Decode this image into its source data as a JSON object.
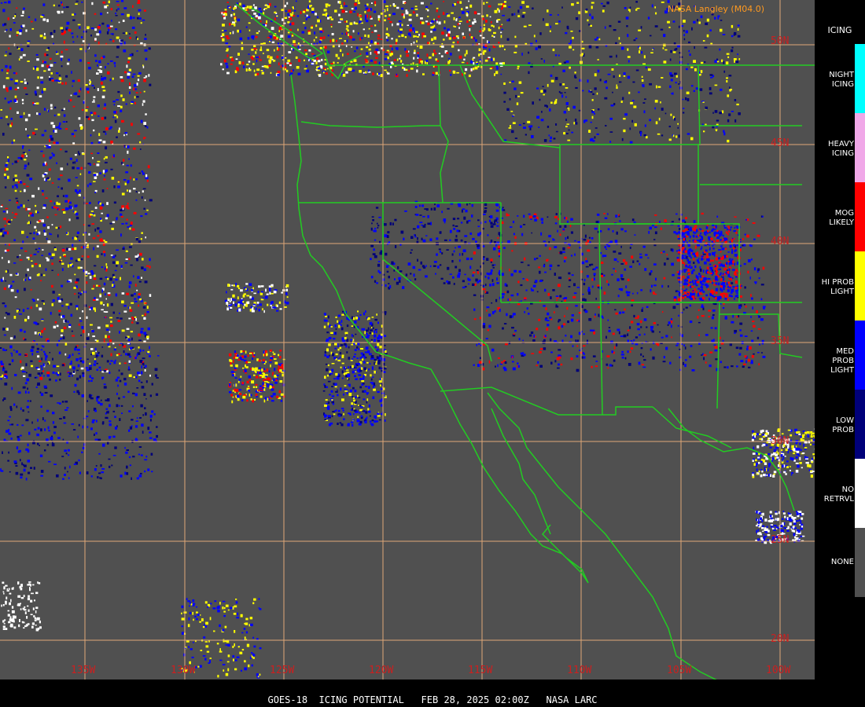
{
  "header": {
    "credit": "NASA Langley (M04.0)"
  },
  "footer": {
    "text": "GOES-18  ICING POTENTIAL   FEB 28, 2025 02:00Z   NASA LARC"
  },
  "legend": {
    "title": "ICING",
    "items": [
      {
        "label": "NIGHT\nICING",
        "color": "#00ffff"
      },
      {
        "label": "HEAVY\nICING",
        "color": "#f0a8e8"
      },
      {
        "label": "MOG\nLIKELY",
        "color": "#ff0000"
      },
      {
        "label": "HI PROB\nLIGHT",
        "color": "#ffff00"
      },
      {
        "label": "MED PROB\nLIGHT",
        "color": "#0000ff"
      },
      {
        "label": "LOW\nPROB",
        "color": "#00007a"
      },
      {
        "label": "NO\nRETRVL",
        "color": "#ffffff"
      },
      {
        "label": "NONE",
        "color": "#505050"
      }
    ]
  },
  "grid": {
    "lat_labels": [
      "50N",
      "45N",
      "40N",
      "35N",
      "30N",
      "25N",
      "20N"
    ],
    "lon_labels": [
      "135W",
      "130W",
      "125W",
      "120W",
      "115W",
      "110W",
      "105W",
      "100W"
    ]
  },
  "colors": {
    "background": "#505050",
    "grid_line": "#e0a878",
    "coastline": "#22cc22",
    "boundary": "#22cc22",
    "label": "#cc1f1f"
  }
}
